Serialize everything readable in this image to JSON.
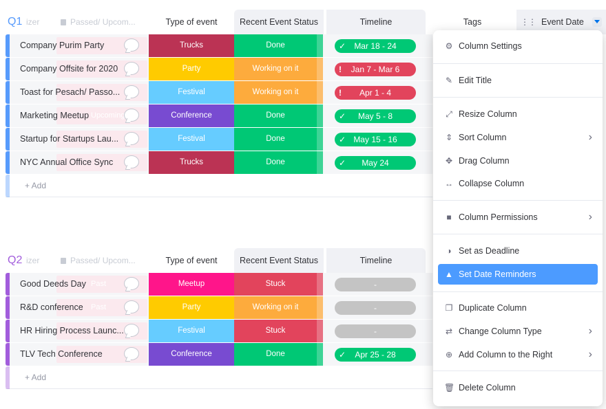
{
  "colors": {
    "done": "#00c875",
    "working": "#fdab3d",
    "stuck": "#e2445c",
    "trucks": "#bb3354",
    "party": "#ffcb00",
    "festival": "#66ccff",
    "conference": "#784bd1",
    "meetup": "#ff158a",
    "accent": "#0073ea"
  },
  "groups": [
    {
      "title": "Q1",
      "ghost_col_a": "izer",
      "ghost_col_b": "Passed/ Upcom...",
      "color": "#579bfc",
      "headers": {
        "type": "Type of event",
        "status": "Recent Event Status",
        "timeline": "Timeline"
      },
      "add_label": "+ Add",
      "rows": [
        {
          "name": "Company Purim Party",
          "ghost": "",
          "type": "Trucks",
          "type_color": "#bb3354",
          "status": "Done",
          "status_color": "#00c875",
          "timeline": "Mar 18 - 24",
          "timeline_state": "done"
        },
        {
          "name": "Company Offsite for 2020",
          "ghost": "",
          "type": "Party",
          "type_color": "#ffcb00",
          "status": "Working on it",
          "status_color": "#fdab3d",
          "timeline": "Jan 7 - Mar 6",
          "timeline_state": "late"
        },
        {
          "name": "Toast for Pesach/ Passo...",
          "ghost": "",
          "type": "Festival",
          "type_color": "#66ccff",
          "status": "Working on it",
          "status_color": "#fdab3d",
          "timeline": "Apr 1 - 4",
          "timeline_state": "late"
        },
        {
          "name": "Marketing Meetup",
          "ghost": "Upcoming",
          "type": "Conference",
          "type_color": "#784bd1",
          "status": "Done",
          "status_color": "#00c875",
          "timeline": "May 5 - 8",
          "timeline_state": "done"
        },
        {
          "name": "Startup for Startups Lau...",
          "ghost": "",
          "type": "Festival",
          "type_color": "#66ccff",
          "status": "Done",
          "status_color": "#00c875",
          "timeline": "May 15 - 16",
          "timeline_state": "done"
        },
        {
          "name": "NYC Annual Office Sync",
          "ghost": "",
          "type": "Trucks",
          "type_color": "#bb3354",
          "status": "Done",
          "status_color": "#00c875",
          "timeline": "May 24",
          "timeline_state": "done"
        }
      ]
    },
    {
      "title": "Q2",
      "ghost_col_a": "izer",
      "ghost_col_b": "Passed/ Upcom...",
      "color": "#a25ddc",
      "headers": {
        "type": "Type of event",
        "status": "Recent Event Status",
        "timeline": "Timeline"
      },
      "add_label": "+ Add",
      "rows": [
        {
          "name": "Good Deeds Day",
          "ghost": "Past",
          "type": "Meetup",
          "type_color": "#ff158a",
          "status": "Stuck",
          "status_color": "#e2445c",
          "timeline": "-",
          "timeline_state": "empty"
        },
        {
          "name": "R&D conference",
          "ghost": "Past",
          "type": "Party",
          "type_color": "#ffcb00",
          "status": "Working on it",
          "status_color": "#fdab3d",
          "timeline": "-",
          "timeline_state": "empty"
        },
        {
          "name": "HR Hiring Process Launc...",
          "ghost": "",
          "type": "Festival",
          "type_color": "#66ccff",
          "status": "Stuck",
          "status_color": "#e2445c",
          "timeline": "-",
          "timeline_state": "empty"
        },
        {
          "name": "TLV Tech Conference",
          "ghost": "",
          "type": "Conference",
          "type_color": "#784bd1",
          "status": "Done",
          "status_color": "#00c875",
          "timeline": "Apr 25 - 28",
          "timeline_state": "done"
        }
      ]
    }
  ],
  "extra_headers": {
    "tags": "Tags",
    "event_date": "Event Date"
  },
  "menu": {
    "items": [
      {
        "name": "column-settings",
        "icon": "gear-icon",
        "glyph": "⚙",
        "label": "Column Settings",
        "arrow": false,
        "active": false
      },
      {
        "name": "edit-title",
        "icon": "pencil-icon",
        "glyph": "✎",
        "label": "Edit Title",
        "arrow": false,
        "active": false
      },
      {
        "name": "resize-column",
        "icon": "resize-icon",
        "glyph": "⤢",
        "label": "Resize Column",
        "arrow": false,
        "active": false
      },
      {
        "name": "sort-column",
        "icon": "sort-icon",
        "glyph": "⇕",
        "label": "Sort Column",
        "arrow": true,
        "active": false
      },
      {
        "name": "drag-column",
        "icon": "move-icon",
        "glyph": "✥",
        "label": "Drag Column",
        "arrow": false,
        "active": false
      },
      {
        "name": "collapse-column",
        "icon": "collapse-icon",
        "glyph": "↔",
        "label": "Collapse Column",
        "arrow": false,
        "active": false
      },
      {
        "name": "column-permissions",
        "icon": "lock-icon",
        "glyph": "■",
        "label": "Column Permissions",
        "arrow": true,
        "active": false
      },
      {
        "name": "set-as-deadline",
        "icon": "half-circle-icon",
        "glyph": "◑",
        "label": "Set as Deadline",
        "arrow": false,
        "active": false
      },
      {
        "name": "set-date-reminders",
        "icon": "bell-icon",
        "glyph": "▲",
        "label": "Set Date Reminders",
        "arrow": false,
        "active": true
      },
      {
        "name": "duplicate-column",
        "icon": "duplicate-icon",
        "glyph": "❐",
        "label": "Duplicate Column",
        "arrow": false,
        "active": false
      },
      {
        "name": "change-column-type",
        "icon": "swap-icon",
        "glyph": "⇄",
        "label": "Change Column Type",
        "arrow": true,
        "active": false
      },
      {
        "name": "add-column-right",
        "icon": "plus-circle-icon",
        "glyph": "⊕",
        "label": "Add Column to the Right",
        "arrow": true,
        "active": false
      },
      {
        "name": "delete-column",
        "icon": "trash-icon",
        "glyph": "🗑",
        "label": "Delete Column",
        "arrow": false,
        "active": false
      }
    ]
  }
}
